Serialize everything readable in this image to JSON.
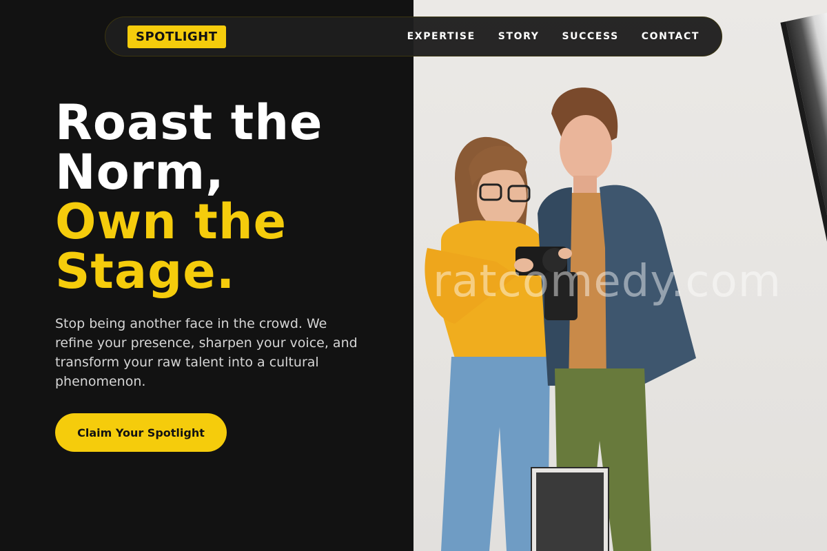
{
  "nav": {
    "logo": "SPOTLIGHT",
    "links": [
      "EXPERTISE",
      "STORY",
      "SUCCESS",
      "CONTACT"
    ]
  },
  "hero": {
    "title_line1": "Roast the Norm,",
    "title_line2": "Own the Stage.",
    "subtitle": "Stop being another face in the crowd. We refine your presence, sharpen your voice, and transform your raw talent into a cultural phenomenon.",
    "cta_label": "Claim Your Spotlight"
  },
  "photo": {
    "watermark": "ratcomedy.com"
  },
  "colors": {
    "accent": "#f5cc0c",
    "background": "#121212"
  }
}
